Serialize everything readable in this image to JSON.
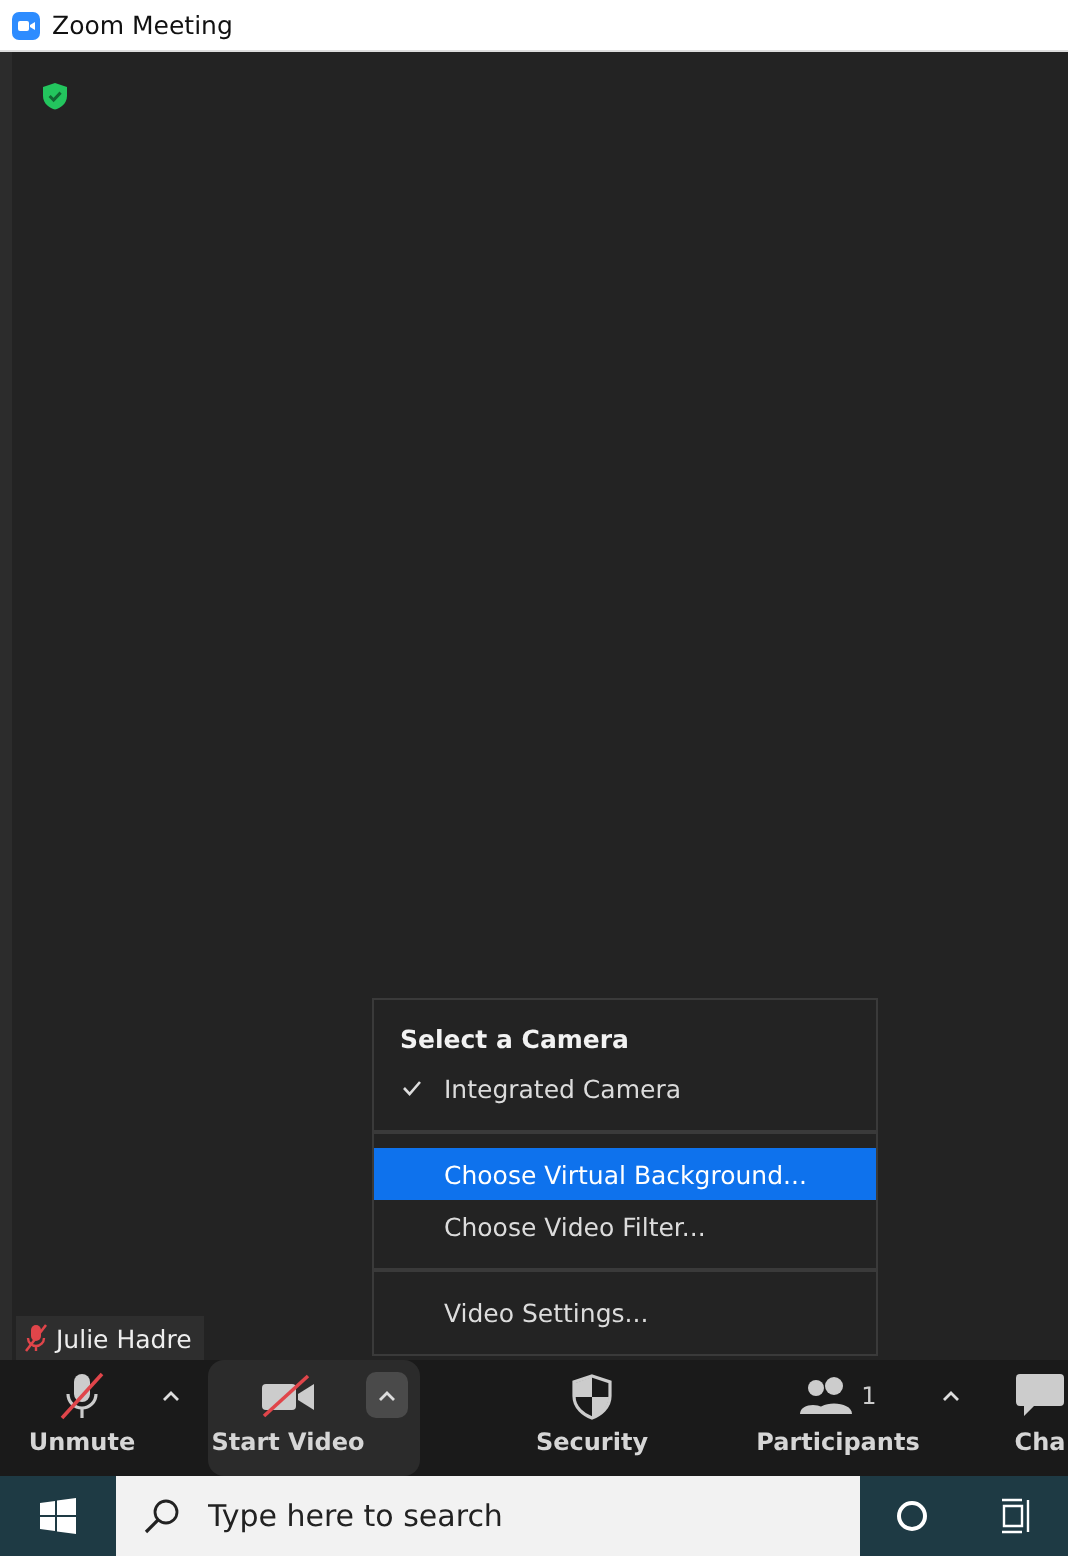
{
  "window": {
    "title": "Zoom Meeting"
  },
  "video": {
    "encrypted": true,
    "participant_name": "Julie Hadre",
    "participant_muted": true
  },
  "camera_menu": {
    "title": "Select a Camera",
    "sections": [
      {
        "items": [
          {
            "label": "Integrated Camera",
            "checked": true,
            "selected": false
          }
        ]
      },
      {
        "items": [
          {
            "label": "Choose Virtual Background...",
            "checked": false,
            "selected": true
          },
          {
            "label": "Choose Video Filter...",
            "checked": false,
            "selected": false
          }
        ]
      },
      {
        "items": [
          {
            "label": "Video Settings...",
            "checked": false,
            "selected": false
          }
        ]
      }
    ]
  },
  "toolbar": [
    {
      "kind": "mic-off",
      "label": "Unmute",
      "caret": true,
      "active": false
    },
    {
      "kind": "video-off",
      "label": "Start Video",
      "caret": true,
      "active": true
    },
    {
      "kind": "shield",
      "label": "Security",
      "caret": false,
      "active": false
    },
    {
      "kind": "people",
      "label": "Participants",
      "count": "1",
      "caret": true,
      "active": false
    },
    {
      "kind": "chat",
      "label": "Cha",
      "caret": false,
      "active": false
    }
  ],
  "taskbar": {
    "search": {
      "placeholder": "Type here to search"
    }
  }
}
